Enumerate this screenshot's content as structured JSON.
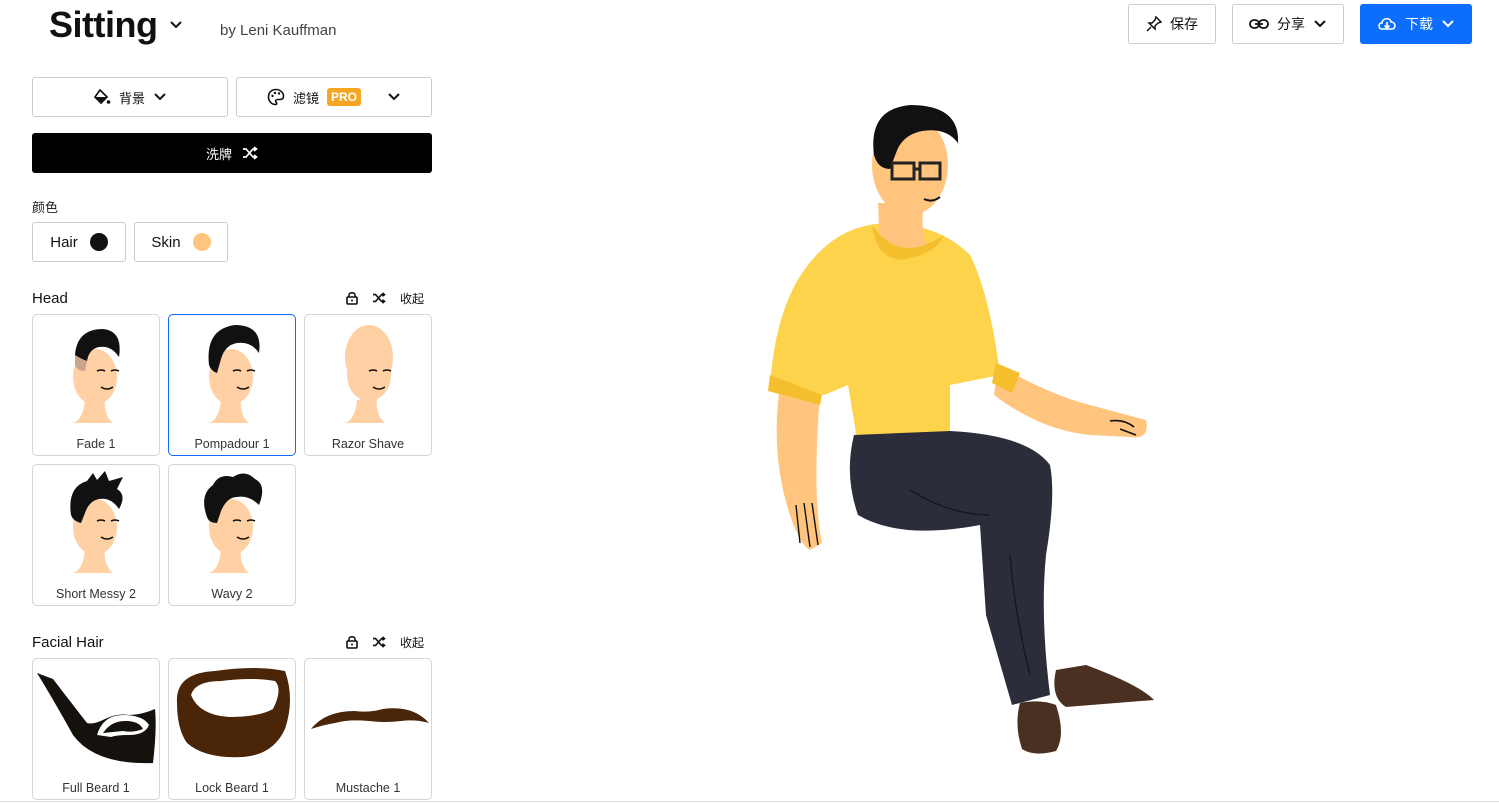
{
  "header": {
    "title": "Sitting",
    "author": "by Leni Kauffman",
    "save_label": "保存",
    "share_label": "分享",
    "download_label": "下载"
  },
  "toolbar": {
    "background_label": "背景",
    "filter_label": "滤镜",
    "pro_badge": "PRO",
    "shuffle_label": "洗牌"
  },
  "colors": {
    "caption": "颜色",
    "hair_label": "Hair",
    "hair_color": "#111111",
    "skin_label": "Skin",
    "skin_color": "#ffc57f"
  },
  "head_section": {
    "title": "Head",
    "collapse_label": "收起",
    "items": [
      {
        "label": "Fade 1"
      },
      {
        "label": "Pompadour 1",
        "selected": true
      },
      {
        "label": "Razor Shave"
      },
      {
        "label": "Short Messy 2"
      },
      {
        "label": "Wavy 2"
      }
    ]
  },
  "facial_hair_section": {
    "title": "Facial Hair",
    "collapse_label": "收起",
    "items": [
      {
        "label": "Full Beard 1"
      },
      {
        "label": "Lock Beard 1"
      },
      {
        "label": "Mustache 1"
      }
    ]
  },
  "palette": {
    "accent": "#0d6efd",
    "pro": "#f5a623",
    "sweater": "#fdd34b",
    "pants": "#2b2d3a",
    "shoes": "#4a3020",
    "skin": "#ffc57f"
  }
}
